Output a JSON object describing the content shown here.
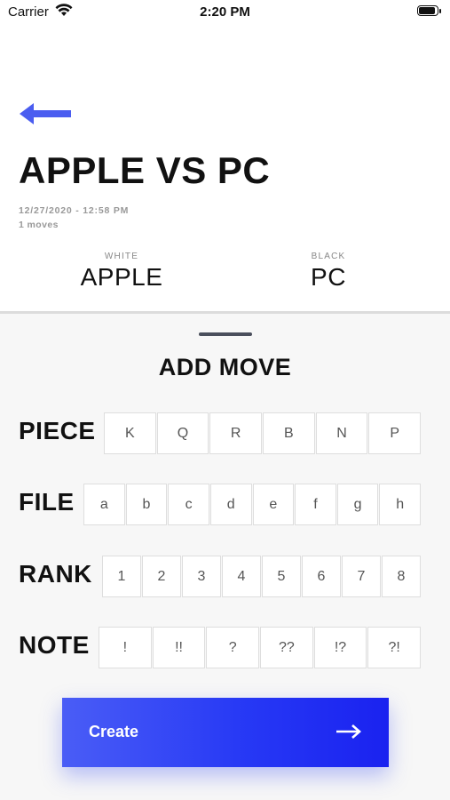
{
  "status_bar": {
    "carrier": "Carrier",
    "time": "2:20 PM"
  },
  "header": {
    "back_icon": "arrow-left-icon",
    "title": "APPLE VS PC",
    "date": "12/27/2020 - 12:58 PM",
    "moves": "1 moves"
  },
  "players": {
    "white": {
      "label": "WHITE",
      "name": "APPLE"
    },
    "black": {
      "label": "BLACK",
      "name": "PC"
    }
  },
  "add_move": {
    "title": "ADD MOVE",
    "piece": {
      "label": "PIECE",
      "options": [
        "K",
        "Q",
        "R",
        "B",
        "N",
        "P"
      ]
    },
    "file": {
      "label": "FILE",
      "options": [
        "a",
        "b",
        "c",
        "d",
        "e",
        "f",
        "g",
        "h"
      ]
    },
    "rank": {
      "label": "RANK",
      "options": [
        "1",
        "2",
        "3",
        "4",
        "5",
        "6",
        "7",
        "8"
      ]
    },
    "note": {
      "label": "NOTE",
      "options": [
        "!",
        "!!",
        "?",
        "??",
        "!?",
        "?!"
      ]
    },
    "create_label": "Create"
  },
  "colors": {
    "accent": "#3246F5",
    "back_arrow": "#4A5DF0"
  }
}
